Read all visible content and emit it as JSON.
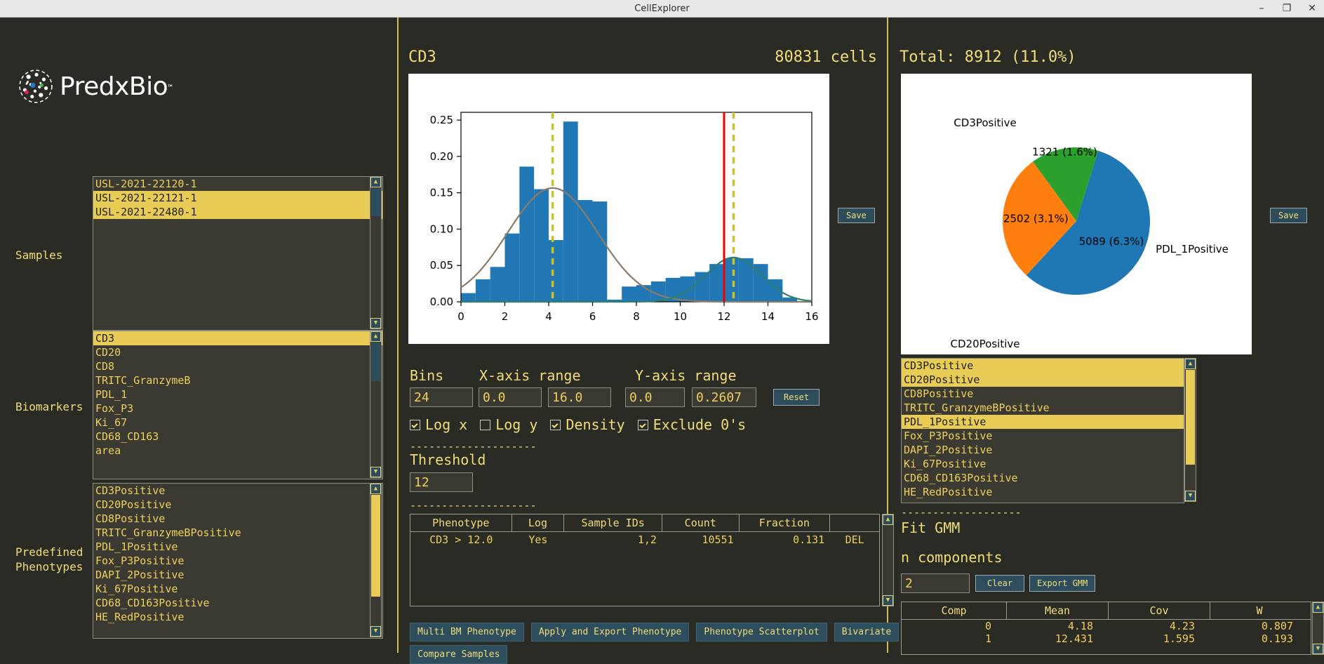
{
  "window": {
    "title": "CellExplorer",
    "minimize": "–",
    "maximize": "❐",
    "close": "✕"
  },
  "brand": {
    "name": "PredxBio",
    "tm": "™"
  },
  "left": {
    "samples_label": "Samples",
    "biomarkers_label": "Biomarkers",
    "phenotypes_label_line1": "Predefined",
    "phenotypes_label_line2": "Phenotypes",
    "samples": [
      {
        "label": "USL-2021-22120-1",
        "selected": false
      },
      {
        "label": "USL-2021-22121-1",
        "selected": true
      },
      {
        "label": "USL-2021-22480-1",
        "selected": true
      }
    ],
    "biomarkers": [
      {
        "label": "CD3",
        "selected": true
      },
      {
        "label": "CD20",
        "selected": false
      },
      {
        "label": "CD8",
        "selected": false
      },
      {
        "label": "TRITC_GranzymeB",
        "selected": false
      },
      {
        "label": "PDL_1",
        "selected": false
      },
      {
        "label": "Fox_P3",
        "selected": false
      },
      {
        "label": "Ki_67",
        "selected": false
      },
      {
        "label": "CD68_CD163",
        "selected": false
      },
      {
        "label": "area",
        "selected": false
      }
    ],
    "phenotypes": [
      {
        "label": "CD3Positive",
        "selected": false
      },
      {
        "label": "CD20Positive",
        "selected": false
      },
      {
        "label": "CD8Positive",
        "selected": false
      },
      {
        "label": "TRITC_GranzymeBPositive",
        "selected": false
      },
      {
        "label": "PDL_1Positive",
        "selected": false
      },
      {
        "label": "Fox_P3Positive",
        "selected": false
      },
      {
        "label": "DAPI_2Positive",
        "selected": false
      },
      {
        "label": "Ki_67Positive",
        "selected": false
      },
      {
        "label": "CD68_CD163Positive",
        "selected": false
      },
      {
        "label": "HE_RedPositive",
        "selected": false
      }
    ]
  },
  "center": {
    "biomarker_title": "CD3",
    "cells_count": "80831 cells",
    "save_label": "Save",
    "bins_label": "Bins",
    "xaxis_label": "X-axis range",
    "yaxis_label": "Y-axis range",
    "bins_value": "24",
    "xmin_value": "0.0",
    "xmax_value": "16.0",
    "ymin_value": "0.0",
    "ymax_value": "0.2607",
    "reset_label": "Reset",
    "checkboxes": [
      {
        "label": "Log x",
        "checked": true
      },
      {
        "label": "Log y",
        "checked": false
      },
      {
        "label": "Density",
        "checked": true
      },
      {
        "label": "Exclude 0's",
        "checked": true
      }
    ],
    "divider": "--------------------",
    "threshold_label": "Threshold",
    "threshold_value": "12",
    "table": {
      "headers": [
        "Phenotype",
        "Log",
        "Sample IDs",
        "Count",
        "Fraction",
        ""
      ],
      "rows": [
        [
          "CD3 > 12.0",
          "Yes",
          "1,2",
          "10551",
          "0.131",
          "DEL"
        ]
      ]
    },
    "buttons": [
      "Multi BM Phenotype",
      "Apply and Export Phenotype",
      "Phenotype Scatterplot",
      "Bivariate",
      "Compare Samples"
    ]
  },
  "right": {
    "total_text": "Total: 8912 (11.0%)",
    "save_label": "Save",
    "phenotypes": [
      {
        "label": "CD3Positive",
        "selected": true
      },
      {
        "label": "CD20Positive",
        "selected": true
      },
      {
        "label": "CD8Positive",
        "selected": false
      },
      {
        "label": "TRITC_GranzymeBPositive",
        "selected": false
      },
      {
        "label": "PDL_1Positive",
        "selected": true
      },
      {
        "label": "Fox_P3Positive",
        "selected": false
      },
      {
        "label": "DAPI_2Positive",
        "selected": false
      },
      {
        "label": "Ki_67Positive",
        "selected": false
      },
      {
        "label": "CD68_CD163Positive",
        "selected": false
      },
      {
        "label": "HE_RedPositive",
        "selected": false
      }
    ],
    "divider": "-------------------",
    "fit_gmm_label": "Fit GMM",
    "n_components_label": "n components",
    "n_components_value": "2",
    "clear_label": "Clear",
    "export_gmm_label": "Export GMM",
    "gmm_table": {
      "headers": [
        "Comp",
        "Mean",
        "Cov",
        "W"
      ],
      "rows": [
        [
          "0",
          "4.18",
          "4.23",
          "0.807"
        ],
        [
          "1",
          "12.431",
          "1.595",
          "0.193"
        ]
      ]
    }
  },
  "chart_data": [
    {
      "type": "bar",
      "title": "CD3",
      "xlabel": "",
      "ylabel": "",
      "xlim": [
        0,
        16
      ],
      "ylim": [
        0,
        0.2607
      ],
      "xticks": [
        0,
        2,
        4,
        6,
        8,
        10,
        12,
        14,
        16
      ],
      "yticks": [
        0.0,
        0.05,
        0.1,
        0.15,
        0.2,
        0.25
      ],
      "grid": false,
      "bin_count": 24,
      "bin_width": 0.6667,
      "bar_color": "#2278b4",
      "categories": [
        "0.00-0.67",
        "0.67-1.33",
        "1.33-2.00",
        "2.00-2.67",
        "2.67-3.33",
        "3.33-4.00",
        "4.00-4.67",
        "4.67-5.33",
        "5.33-6.00",
        "6.00-6.67",
        "6.67-7.33",
        "7.33-8.00",
        "8.00-8.67",
        "8.67-9.33",
        "9.33-10.00",
        "10.00-10.67",
        "10.67-11.33",
        "11.33-12.00",
        "12.00-12.67",
        "12.67-13.33",
        "13.33-14.00",
        "14.00-14.67",
        "14.67-15.33",
        "15.33-16.00"
      ],
      "values": [
        0.012,
        0.031,
        0.048,
        0.094,
        0.186,
        0.155,
        0.085,
        0.248,
        0.14,
        0.138,
        0.003,
        0.021,
        0.023,
        0.028,
        0.033,
        0.035,
        0.041,
        0.052,
        0.06,
        0.06,
        0.052,
        0.031,
        0.006,
        0.001
      ],
      "overlays": [
        {
          "name": "gmm-component-0",
          "type": "line",
          "color": "#8a7a68",
          "mean": 4.18,
          "cov": 4.23,
          "weight": 0.807,
          "peak": 0.157
        },
        {
          "name": "gmm-component-1",
          "type": "line",
          "color": "#2d7f6e",
          "mean": 12.431,
          "cov": 1.595,
          "weight": 0.193,
          "peak": 0.062
        },
        {
          "name": "gmm-mean-marker-0",
          "type": "vline-dashed",
          "color": "#cfc022",
          "x": 4.18
        },
        {
          "name": "gmm-mean-marker-1",
          "type": "vline-dashed",
          "color": "#cfc022",
          "x": 12.431
        },
        {
          "name": "threshold-line",
          "type": "vline",
          "color": "#ee0000",
          "x": 12.0
        }
      ]
    },
    {
      "type": "pie",
      "title": "",
      "total": 8912,
      "total_percent": "11.0%",
      "labels": [
        "CD3Positive",
        "CD20Positive",
        "PDL_1Positive"
      ],
      "values": [
        5089,
        2502,
        1321
      ],
      "value_labels": [
        "5089 (6.3%)",
        "2502 (3.1%)",
        "1321 (1.6%)"
      ],
      "colors": [
        "#1f77b4",
        "#ff7f0e",
        "#2ca02c"
      ],
      "legend": "labels-around-slices"
    }
  ]
}
